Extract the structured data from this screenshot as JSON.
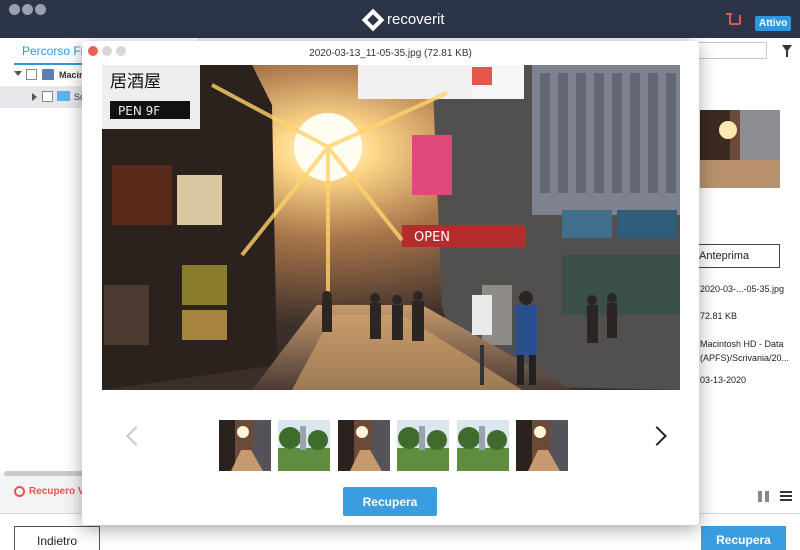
{
  "app": {
    "brand": "recoverit",
    "status_badge": "Attivo"
  },
  "sidebar": {
    "tab_label": "Percorso File",
    "tree": [
      {
        "label": "Macin"
      },
      {
        "label": "Sc"
      }
    ],
    "recovery_link": "Recupero Vi"
  },
  "details": {
    "preview_button": "Anteprima",
    "filename": "2020-03-...-05-35.jpg",
    "size": "72.81 KB",
    "path": "Macintosh HD - Data (APFS)/Scrivania/20...",
    "date": "03-13-2020"
  },
  "footer": {
    "back_label": "Indietro",
    "recover_label": "Recupera"
  },
  "preview": {
    "title": "2020-03-13_11-05-35.jpg (72.81 KB)",
    "recover_label": "Recupera",
    "photo_signs": [
      "OPEN"
    ],
    "thumbnails": [
      {
        "kind": "street"
      },
      {
        "kind": "park"
      },
      {
        "kind": "street"
      },
      {
        "kind": "park"
      },
      {
        "kind": "park"
      },
      {
        "kind": "street"
      }
    ]
  },
  "colors": {
    "titlebar": "#2c3447",
    "accent": "#3a9de0",
    "alert": "#e2574c"
  }
}
